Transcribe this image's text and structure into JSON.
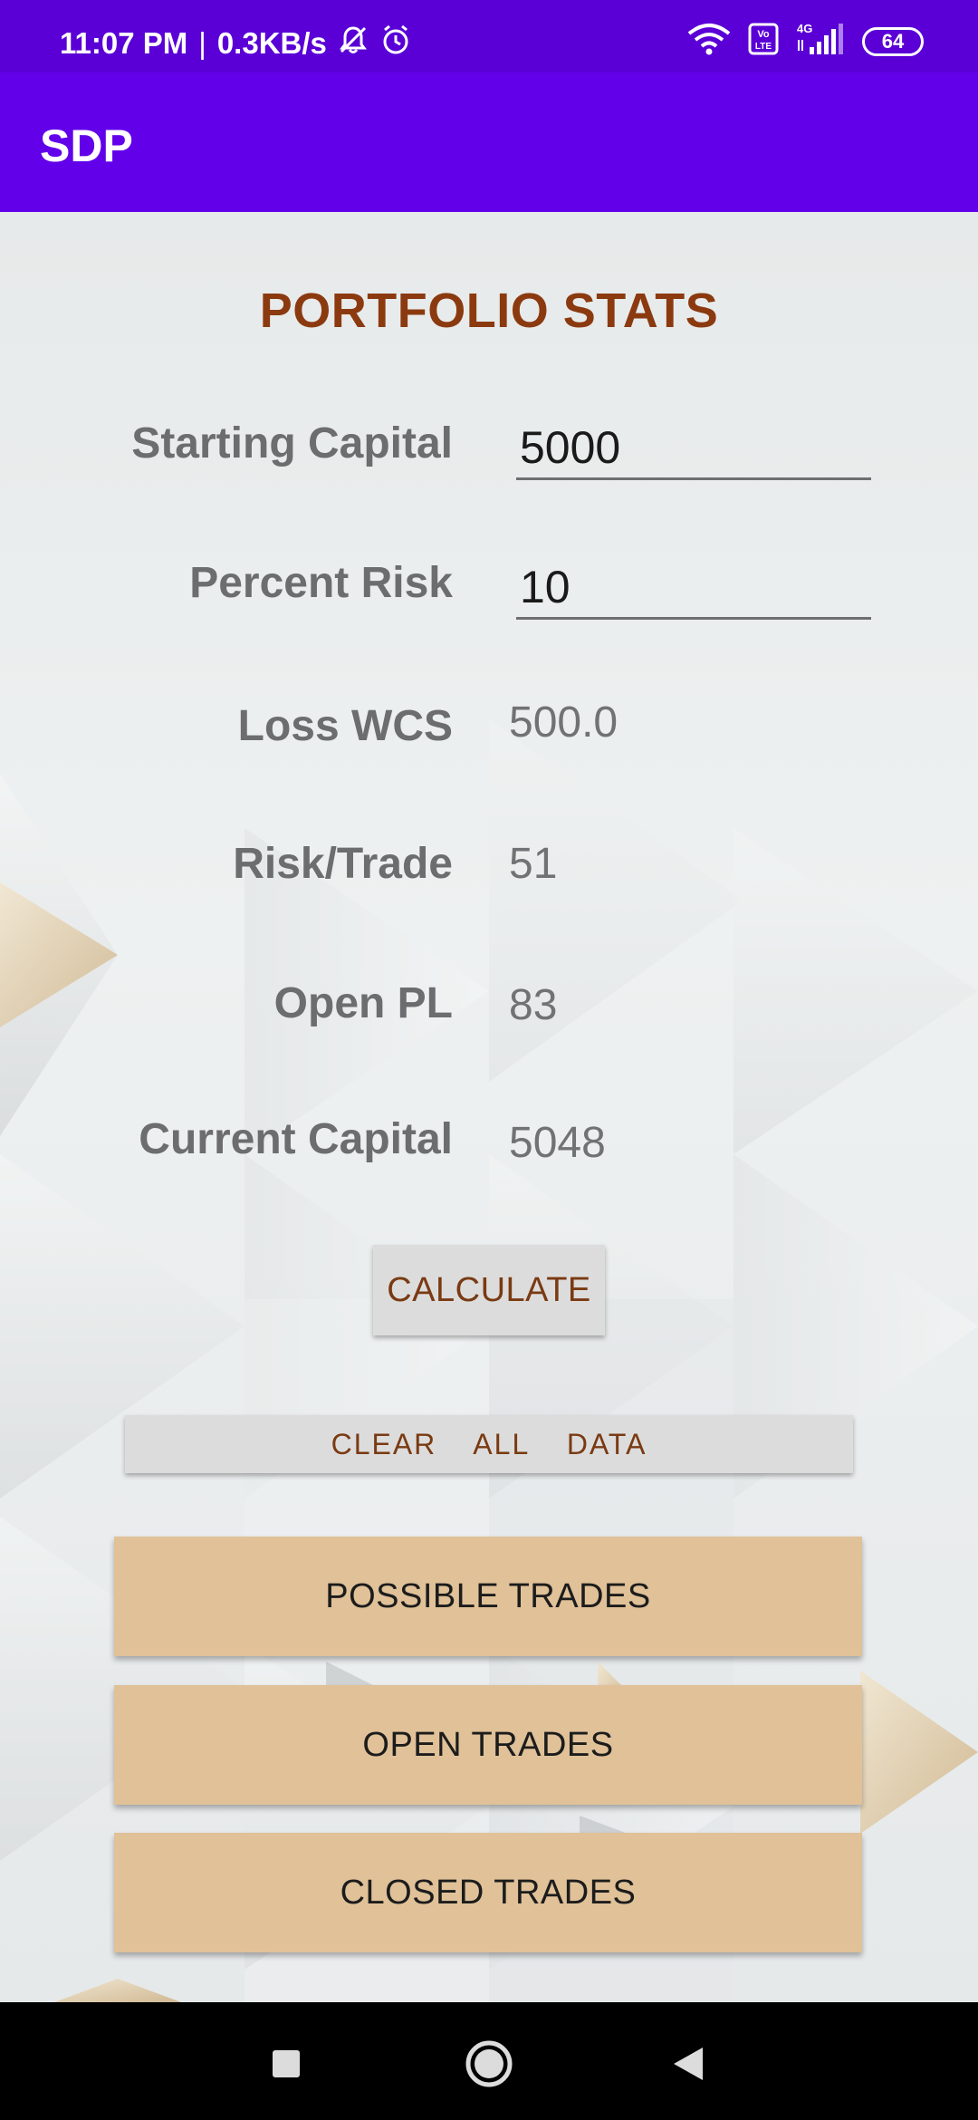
{
  "status_bar": {
    "time": "11:07 PM",
    "separator": "|",
    "speed": "0.3KB/s",
    "network_label": "4G",
    "volte_label": "Vo\nLTE",
    "battery": "64"
  },
  "app_bar": {
    "title": "SDP"
  },
  "portfolio": {
    "heading": "PORTFOLIO STATS",
    "starting_capital": {
      "label": "Starting Capital",
      "value": "5000"
    },
    "percent_risk": {
      "label": "Percent Risk",
      "value": "10"
    },
    "loss_wcs": {
      "label": "Loss WCS",
      "value": "500.0"
    },
    "risk_trade": {
      "label": "Risk/Trade",
      "value": "51"
    },
    "open_pl": {
      "label": "Open PL",
      "value": "83"
    },
    "current_capital": {
      "label": "Current Capital",
      "value": "5048"
    }
  },
  "actions": {
    "calculate": "CALCULATE",
    "clear_all": "CLEAR  ALL  DATA",
    "possible_trades": "POSSIBLE TRADES",
    "open_trades": "OPEN TRADES",
    "closed_trades": "CLOSED TRADES"
  },
  "colors": {
    "status_bar": "#5a00d6",
    "app_bar": "#6200ea",
    "heading": "#8b3a10",
    "nav_button": "#e0c198",
    "grey_button": "#dcdcdc"
  },
  "icons": {
    "status": [
      "muted-bell-icon",
      "alarm-icon",
      "wifi-icon",
      "volte-icon",
      "signal-icon",
      "battery-icon"
    ],
    "navigation": [
      "recents-icon",
      "home-icon",
      "back-icon"
    ]
  }
}
